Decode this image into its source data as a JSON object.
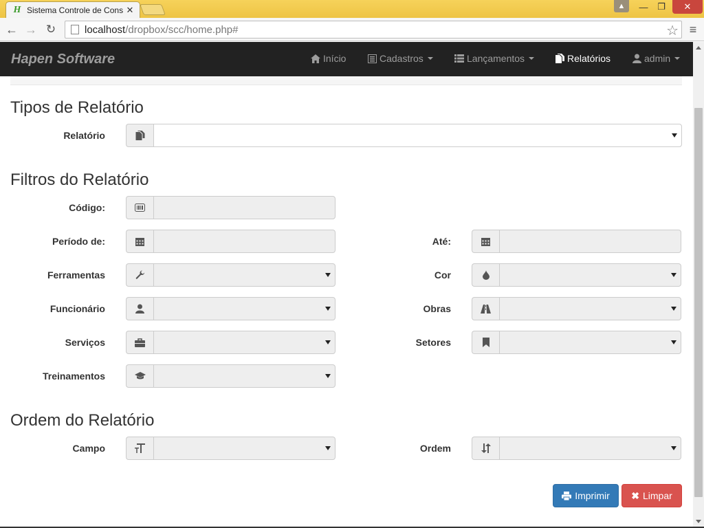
{
  "browser": {
    "tab_title": "Sistema Controle de Cons",
    "favicon_letter": "H",
    "url_host": "localhost",
    "url_path": "/dropbox/scc/home.php#"
  },
  "navbar": {
    "brand": "Hapen Software",
    "items": [
      {
        "label": "Início",
        "icon": "home-icon"
      },
      {
        "label": "Cadastros",
        "icon": "list-alt-icon",
        "dropdown": true
      },
      {
        "label": "Lançamentos",
        "icon": "th-list-icon",
        "dropdown": true
      },
      {
        "label": "Relatórios",
        "icon": "duplicate-icon",
        "active": true
      },
      {
        "label": "admin",
        "icon": "user-icon",
        "dropdown": true
      }
    ]
  },
  "sections": {
    "tipos": "Tipos de Relatório",
    "filtros": "Filtros do Relatório",
    "ordem": "Ordem do Relatório"
  },
  "fields": {
    "relatorio": {
      "label": "Relatório",
      "value": ""
    },
    "codigo": {
      "label": "Código:",
      "value": ""
    },
    "periodo_de": {
      "label": "Período de:",
      "value": ""
    },
    "ate": {
      "label": "Até:",
      "value": ""
    },
    "ferramentas": {
      "label": "Ferramentas",
      "value": ""
    },
    "cor": {
      "label": "Cor",
      "value": ""
    },
    "funcionario": {
      "label": "Funcionário",
      "value": ""
    },
    "obras": {
      "label": "Obras",
      "value": ""
    },
    "servicos": {
      "label": "Serviços",
      "value": ""
    },
    "setores": {
      "label": "Setores",
      "value": ""
    },
    "treinamentos": {
      "label": "Treinamentos",
      "value": ""
    },
    "campo": {
      "label": "Campo",
      "value": ""
    },
    "ordem": {
      "label": "Ordem",
      "value": ""
    }
  },
  "buttons": {
    "imprimir": "Imprimir",
    "limpar": "Limpar"
  },
  "colors": {
    "navbar_bg": "#222222",
    "primary": "#337ab7",
    "danger": "#d9534f",
    "chrome_frame": "#f2c94c"
  }
}
